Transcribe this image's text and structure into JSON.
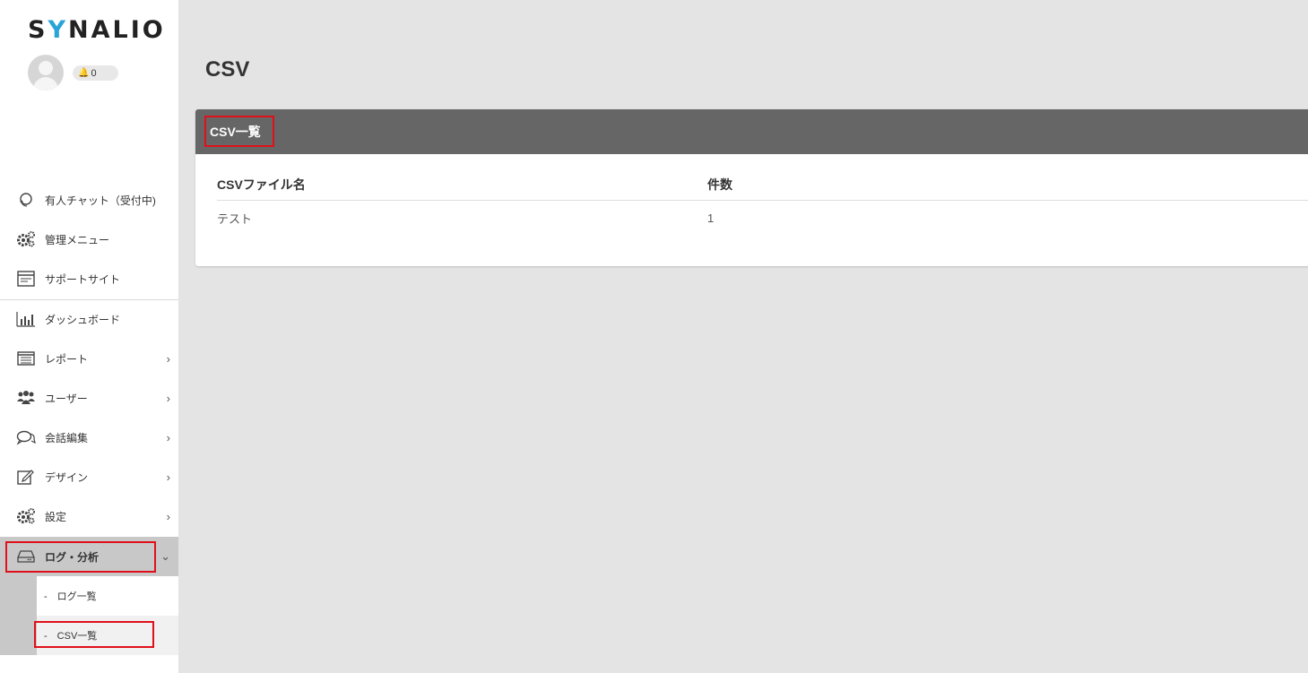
{
  "brand": {
    "logo_pre": "S",
    "logo_y": "Y",
    "logo_post": "NALIO"
  },
  "user": {
    "notification_count": "0"
  },
  "sidebar": {
    "items": [
      {
        "label": "有人チャット（受付中)",
        "icon": "headset-icon",
        "chevron": false
      },
      {
        "label": "管理メニュー",
        "icon": "gears-icon",
        "chevron": false
      },
      {
        "label": "サポートサイト",
        "icon": "browser-window-icon",
        "chevron": false
      },
      {
        "label": "ダッシュボード",
        "icon": "bar-chart-icon",
        "chevron": false
      },
      {
        "label": "レポート",
        "icon": "list-window-icon",
        "chevron": true
      },
      {
        "label": "ユーザー",
        "icon": "users-icon",
        "chevron": true
      },
      {
        "label": "会話編集",
        "icon": "chat-bubbles-icon",
        "chevron": true
      },
      {
        "label": "デザイン",
        "icon": "edit-icon",
        "chevron": true
      },
      {
        "label": "設定",
        "icon": "gears-icon",
        "chevron": true
      },
      {
        "label": "ログ・分析",
        "icon": "drive-icon",
        "chevron": true
      }
    ],
    "sub_items": [
      {
        "label": "-　ログ一覧"
      },
      {
        "label": "-　CSV一覧"
      }
    ],
    "chevron_right": "›",
    "chevron_down": "⌄"
  },
  "main": {
    "title": "CSV",
    "card_title": "CSV一覧",
    "table": {
      "headers": [
        "CSVファイル名",
        "件数"
      ],
      "rows": [
        [
          "テスト",
          "1"
        ]
      ]
    }
  },
  "colors": {
    "accent_highlight": "#e0101b",
    "card_header": "#666666",
    "logo_y": "#2aa3d8"
  }
}
